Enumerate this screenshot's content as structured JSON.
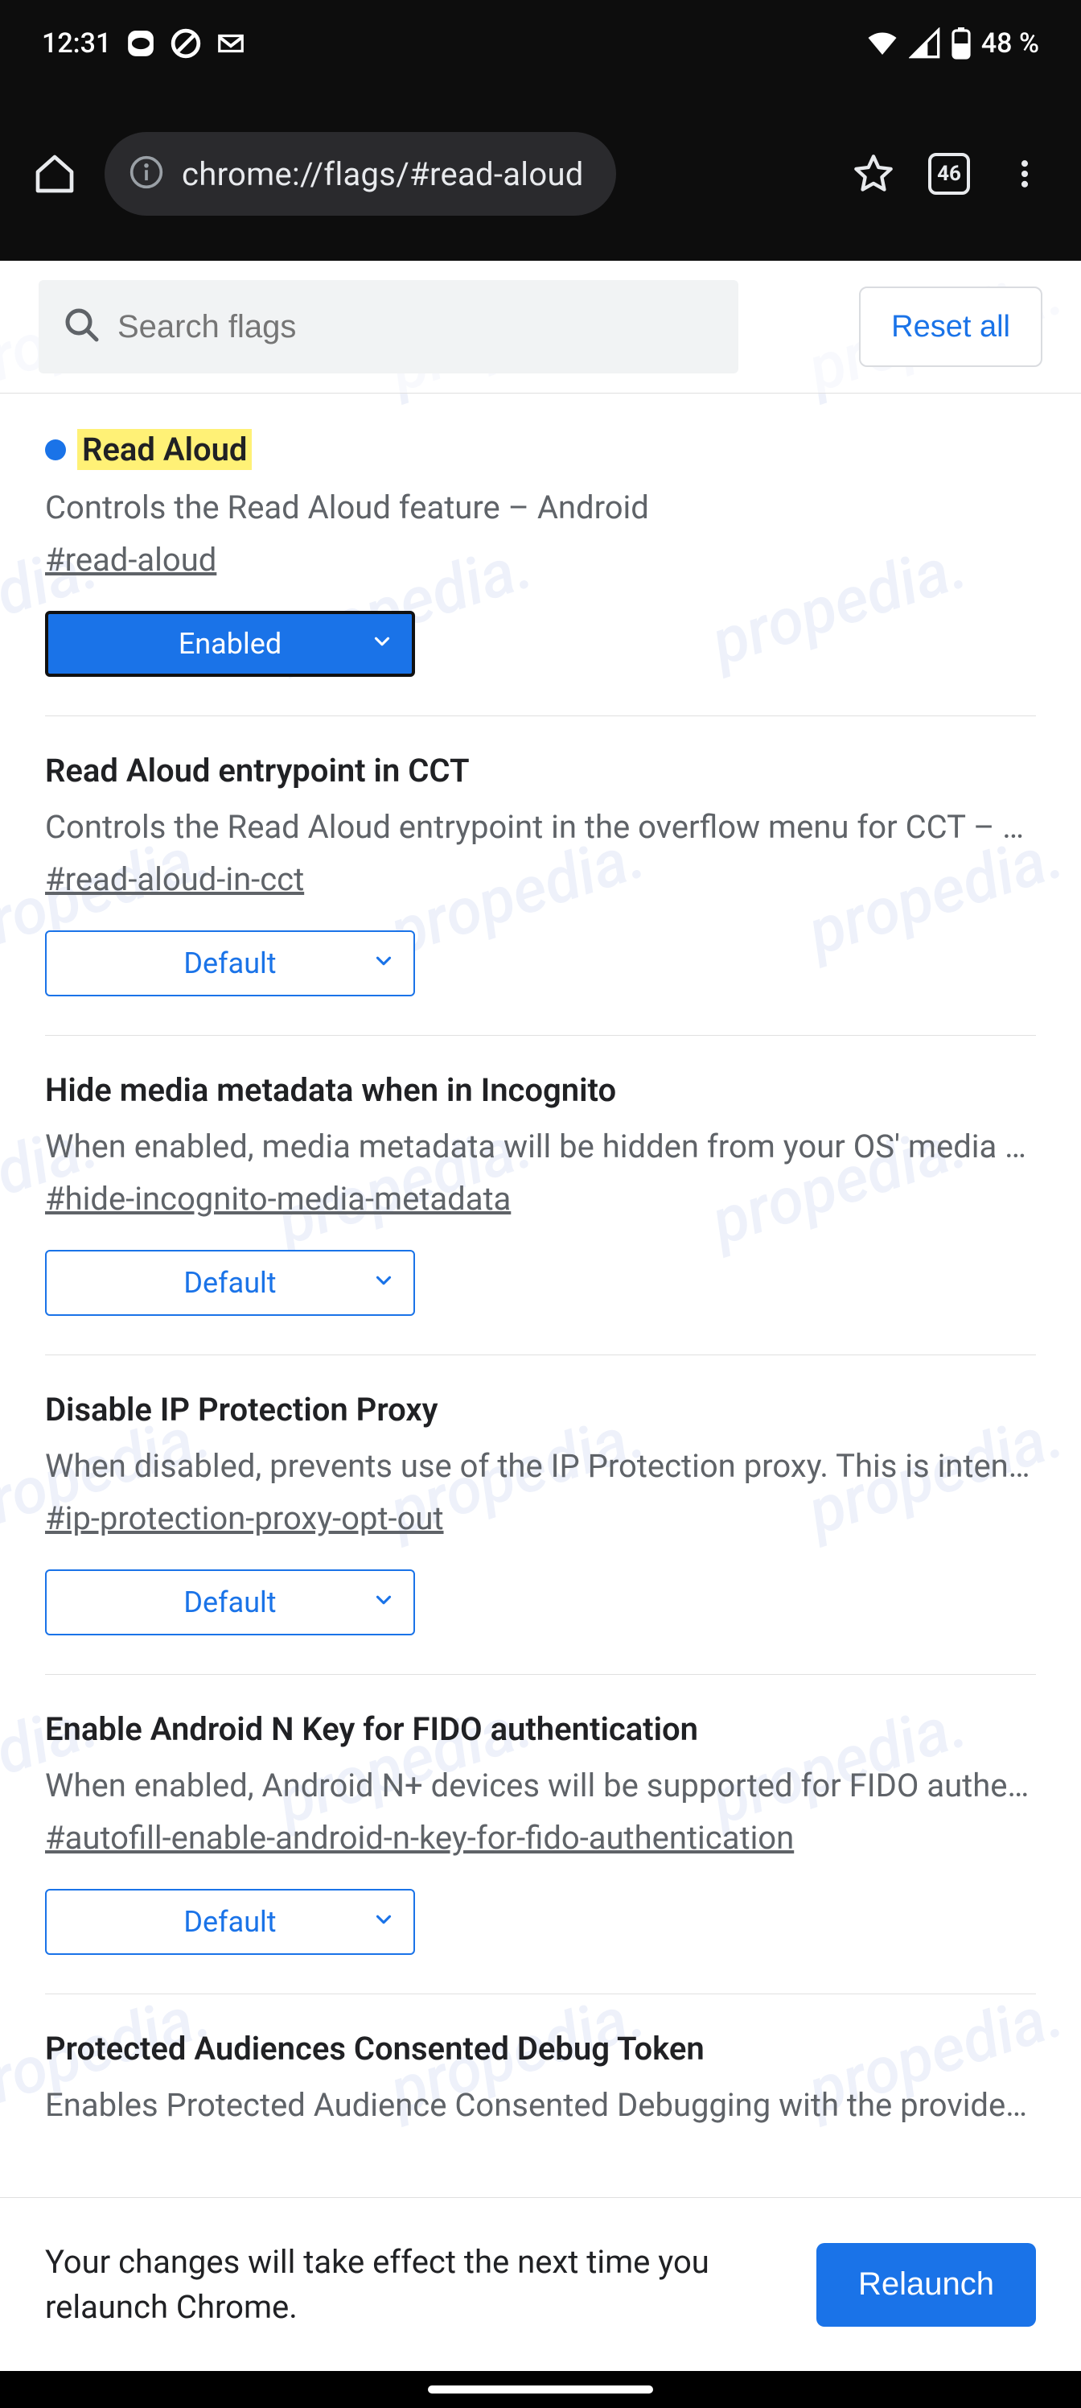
{
  "status": {
    "time": "12:31",
    "battery_pct": "48 %"
  },
  "browser": {
    "url": "chrome://flags/#read-aloud",
    "tab_count": "46"
  },
  "header": {
    "search_placeholder": "Search flags",
    "reset_label": "Reset all"
  },
  "watermark": "propedia.",
  "flags": [
    {
      "title": "Read Aloud",
      "highlighted": true,
      "desc": "Controls the Read Aloud feature – Android",
      "anchor": "#read-aloud",
      "value": "Enabled",
      "enabled": true
    },
    {
      "title": "Read Aloud entrypoint in CCT",
      "desc": "Controls the Read Aloud entrypoint in the overflow menu for CCT – …",
      "anchor": "#read-aloud-in-cct",
      "value": "Default"
    },
    {
      "title": "Hide media metadata when in Incognito",
      "desc": "When enabled, media metadata will be hidden from your OS' media p…",
      "anchor": "#hide-incognito-media-metadata",
      "value": "Default"
    },
    {
      "title": "Disable IP Protection Proxy",
      "desc": "When disabled, prevents use of the IP Protection proxy. This is inten…",
      "anchor": "#ip-protection-proxy-opt-out",
      "value": "Default"
    },
    {
      "title": "Enable Android N Key for FIDO authentication",
      "desc": "When enabled, Android N+ devices will be supported for FIDO authe…",
      "anchor": "#autofill-enable-android-n-key-for-fido-authentication",
      "value": "Default"
    },
    {
      "title": "Protected Audiences Consented Debug Token",
      "desc": "Enables Protected Audience Consented Debugging with the provide…",
      "anchor": "",
      "value": ""
    }
  ],
  "footer": {
    "message": "Your changes will take effect the next time you relaunch Chrome.",
    "button": "Relaunch"
  }
}
